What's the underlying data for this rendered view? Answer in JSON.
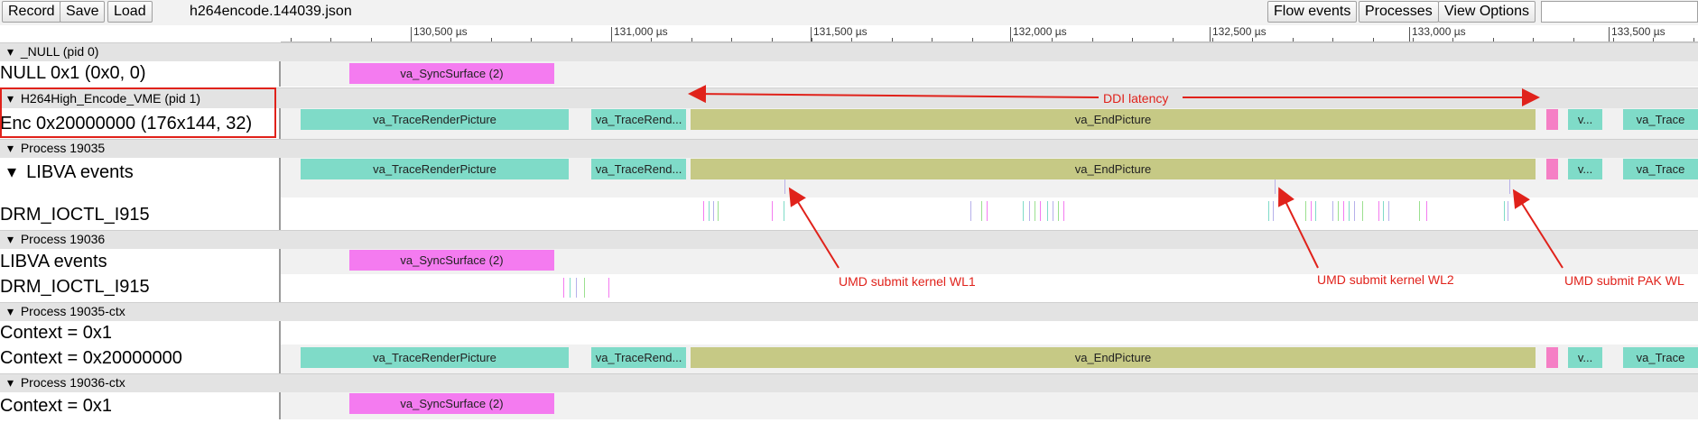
{
  "toolbar": {
    "record_label": "Record",
    "save_label": "Save",
    "load_label": "Load",
    "filename": "h264encode.144039.json",
    "flow_events_label": "Flow events",
    "processes_label": "Processes",
    "view_options_label": "View Options",
    "search_value": ""
  },
  "ruler": {
    "ticks": [
      "130,500 µs",
      "131,000 µs",
      "131,500 µs",
      "132,000 µs",
      "132,500 µs",
      "133,000 µs",
      "133,500 µs"
    ]
  },
  "rows": {
    "null_proc": "_NULL (pid 0)",
    "null_thread": "NULL 0x1 (0x0, 0)",
    "h264_proc": "H264High_Encode_VME (pid 1)",
    "enc_thread": "Enc 0x20000000 (176x144, 32)",
    "p19035": "Process 19035",
    "libva_events_1": "LIBVA events",
    "drm_1": "DRM_IOCTL_I915",
    "p19036": "Process 19036",
    "libva_events_2": "LIBVA events",
    "drm_2": "DRM_IOCTL_I915",
    "p19035ctx": "Process 19035-ctx",
    "ctx_0x1_a": "Context = 0x1",
    "ctx_0x2": "Context = 0x20000000",
    "p19036ctx": "Process 19036-ctx",
    "ctx_0x1_b": "Context = 0x1"
  },
  "slices": {
    "sync_surface": "va_SyncSurface (2)",
    "trace_render": "va_TraceRenderPicture",
    "trace_rend_short": "va_TraceRend...",
    "end_picture": "va_EndPicture",
    "v_short": "v...",
    "va_trace_cut": "va_Trace"
  },
  "annotations": {
    "ddi_latency": "DDI latency",
    "wl1": "UMD submit kernel WL1",
    "wl2": "UMD submit kernel WL2",
    "pak": "UMD submit PAK WL"
  },
  "colors": {
    "teal": "#7fdbc8",
    "olive": "#c6c985",
    "magenta": "#f47bf0",
    "annotation_red": "#e0221b"
  }
}
